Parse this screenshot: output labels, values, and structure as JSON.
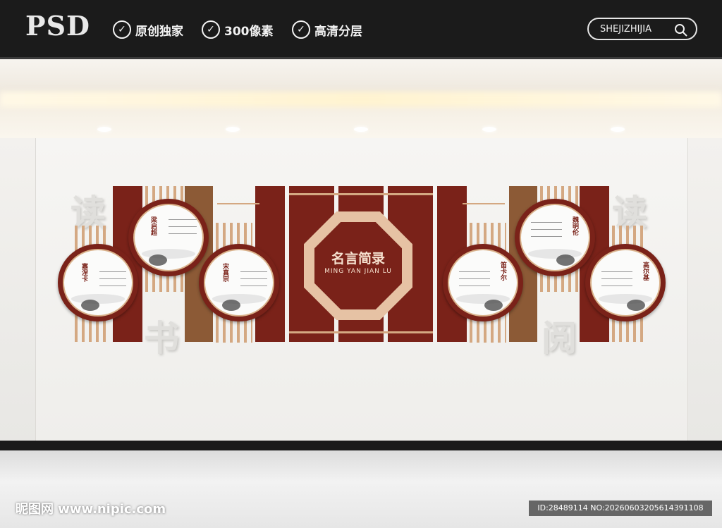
{
  "header": {
    "logo": "PSD",
    "features": [
      "原创独家",
      "300像素",
      "高清分层"
    ],
    "search_text": "SHEJIZHIJIA"
  },
  "wall": {
    "ghost_chars": [
      "读",
      "书",
      "读",
      "阅"
    ],
    "center": {
      "title": "名言简录",
      "subtitle": "MING YAN JIAN LU"
    },
    "portraits": [
      {
        "name": "塞涅卡"
      },
      {
        "name": "梁启超"
      },
      {
        "name": "宋真宗"
      },
      {
        "name": "笛卡尔"
      },
      {
        "name": "魏明伦"
      },
      {
        "name": "高尔基"
      }
    ]
  },
  "footer": {
    "watermark": "昵图网 www.nipic.com",
    "id": "ID:28489114 NO:20260603205614391108"
  }
}
